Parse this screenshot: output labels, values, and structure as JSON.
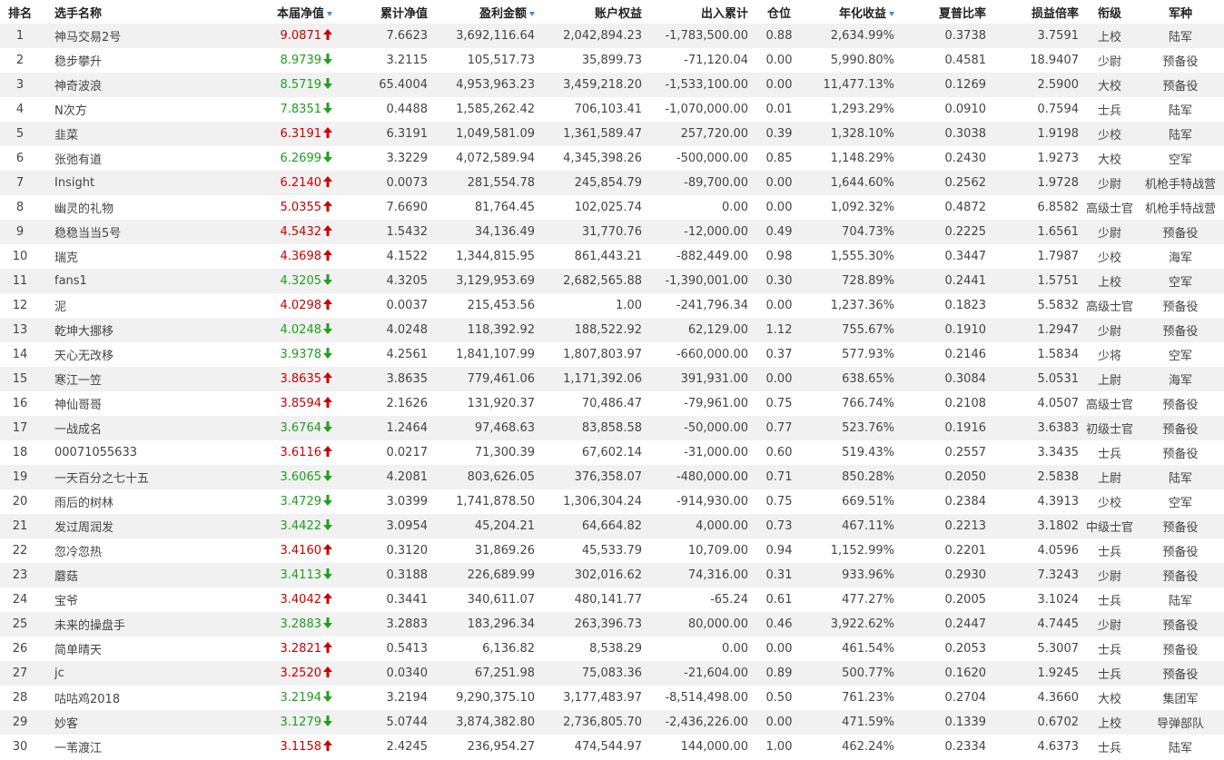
{
  "header": {
    "rank": "排名",
    "name": "选手名称",
    "nav": "本届净值",
    "cum_nav": "累计净值",
    "profit": "盈利金额",
    "equity": "账户权益",
    "flow": "出入累计",
    "position": "仓位",
    "annual": "年化收益",
    "sharpe": "夏普比率",
    "pl_ratio": "损益倍率",
    "title": "衔级",
    "branch": "军种"
  },
  "sorted_columns": [
    "nav",
    "profit",
    "annual"
  ],
  "colors": {
    "up": "#cc0000",
    "down": "#1ea01e",
    "sort_icon": "#3a8ee6",
    "stripe": "#f1f1f1"
  },
  "rows": [
    {
      "rank": "1",
      "name": "神马交易2号",
      "nav": "9.0871",
      "dir": "up",
      "cum_nav": "7.6623",
      "profit": "3,692,116.64",
      "equity": "2,042,894.23",
      "flow": "-1,783,500.00",
      "position": "0.88",
      "annual": "2,634.99%",
      "sharpe": "0.3738",
      "pl_ratio": "3.7591",
      "title": "上校",
      "branch": "陆军"
    },
    {
      "rank": "2",
      "name": "稳步攀升",
      "nav": "8.9739",
      "dir": "down",
      "cum_nav": "3.2115",
      "profit": "105,517.73",
      "equity": "35,899.73",
      "flow": "-71,120.04",
      "position": "0.00",
      "annual": "5,990.80%",
      "sharpe": "0.4581",
      "pl_ratio": "18.9407",
      "title": "少尉",
      "branch": "预备役"
    },
    {
      "rank": "3",
      "name": "神奇波浪",
      "nav": "8.5719",
      "dir": "down",
      "cum_nav": "65.4004",
      "profit": "4,953,963.23",
      "equity": "3,459,218.20",
      "flow": "-1,533,100.00",
      "position": "0.00",
      "annual": "11,477.13%",
      "sharpe": "0.1269",
      "pl_ratio": "2.5900",
      "title": "大校",
      "branch": "预备役"
    },
    {
      "rank": "4",
      "name": "N次方",
      "nav": "7.8351",
      "dir": "down",
      "cum_nav": "0.4488",
      "profit": "1,585,262.42",
      "equity": "706,103.41",
      "flow": "-1,070,000.00",
      "position": "0.01",
      "annual": "1,293.29%",
      "sharpe": "0.0910",
      "pl_ratio": "0.7594",
      "title": "士兵",
      "branch": "陆军"
    },
    {
      "rank": "5",
      "name": "韭菜",
      "nav": "6.3191",
      "dir": "up",
      "cum_nav": "6.3191",
      "profit": "1,049,581.09",
      "equity": "1,361,589.47",
      "flow": "257,720.00",
      "position": "0.39",
      "annual": "1,328.10%",
      "sharpe": "0.3038",
      "pl_ratio": "1.9198",
      "title": "少校",
      "branch": "陆军"
    },
    {
      "rank": "6",
      "name": "张弛有道",
      "nav": "6.2699",
      "dir": "down",
      "cum_nav": "3.3229",
      "profit": "4,072,589.94",
      "equity": "4,345,398.26",
      "flow": "-500,000.00",
      "position": "0.85",
      "annual": "1,148.29%",
      "sharpe": "0.2430",
      "pl_ratio": "1.9273",
      "title": "大校",
      "branch": "空军"
    },
    {
      "rank": "7",
      "name": "Insight",
      "nav": "6.2140",
      "dir": "up",
      "cum_nav": "0.0073",
      "profit": "281,554.78",
      "equity": "245,854.79",
      "flow": "-89,700.00",
      "position": "0.00",
      "annual": "1,644.60%",
      "sharpe": "0.2562",
      "pl_ratio": "1.9728",
      "title": "少尉",
      "branch": "机枪手特战营"
    },
    {
      "rank": "8",
      "name": "幽灵的礼物",
      "nav": "5.0355",
      "dir": "up",
      "cum_nav": "7.6690",
      "profit": "81,764.45",
      "equity": "102,025.74",
      "flow": "0.00",
      "position": "0.00",
      "annual": "1,092.32%",
      "sharpe": "0.4872",
      "pl_ratio": "6.8582",
      "title": "高级士官",
      "branch": "机枪手特战营"
    },
    {
      "rank": "9",
      "name": "稳稳当当5号",
      "nav": "4.5432",
      "dir": "up",
      "cum_nav": "1.5432",
      "profit": "34,136.49",
      "equity": "31,770.76",
      "flow": "-12,000.00",
      "position": "0.49",
      "annual": "704.73%",
      "sharpe": "0.2225",
      "pl_ratio": "1.6561",
      "title": "少尉",
      "branch": "预备役"
    },
    {
      "rank": "10",
      "name": "瑞克",
      "nav": "4.3698",
      "dir": "up",
      "cum_nav": "4.1522",
      "profit": "1,344,815.95",
      "equity": "861,443.21",
      "flow": "-882,449.00",
      "position": "0.98",
      "annual": "1,555.30%",
      "sharpe": "0.3447",
      "pl_ratio": "1.7987",
      "title": "少校",
      "branch": "海军"
    },
    {
      "rank": "11",
      "name": "fans1",
      "nav": "4.3205",
      "dir": "down",
      "cum_nav": "4.3205",
      "profit": "3,129,953.69",
      "equity": "2,682,565.88",
      "flow": "-1,390,001.00",
      "position": "0.30",
      "annual": "728.89%",
      "sharpe": "0.2441",
      "pl_ratio": "1.5751",
      "title": "上校",
      "branch": "空军"
    },
    {
      "rank": "12",
      "name": "泥",
      "nav": "4.0298",
      "dir": "up",
      "cum_nav": "0.0037",
      "profit": "215,453.56",
      "equity": "1.00",
      "flow": "-241,796.34",
      "position": "0.00",
      "annual": "1,237.36%",
      "sharpe": "0.1823",
      "pl_ratio": "5.5832",
      "title": "高级士官",
      "branch": "预备役"
    },
    {
      "rank": "13",
      "name": "乾坤大挪移",
      "nav": "4.0248",
      "dir": "down",
      "cum_nav": "4.0248",
      "profit": "118,392.92",
      "equity": "188,522.92",
      "flow": "62,129.00",
      "position": "1.12",
      "annual": "755.67%",
      "sharpe": "0.1910",
      "pl_ratio": "1.2947",
      "title": "少尉",
      "branch": "预备役"
    },
    {
      "rank": "14",
      "name": "天心无改移",
      "nav": "3.9378",
      "dir": "down",
      "cum_nav": "4.2561",
      "profit": "1,841,107.99",
      "equity": "1,807,803.97",
      "flow": "-660,000.00",
      "position": "0.37",
      "annual": "577.93%",
      "sharpe": "0.2146",
      "pl_ratio": "1.5834",
      "title": "少将",
      "branch": "空军"
    },
    {
      "rank": "15",
      "name": "寒江一笠",
      "nav": "3.8635",
      "dir": "up",
      "cum_nav": "3.8635",
      "profit": "779,461.06",
      "equity": "1,171,392.06",
      "flow": "391,931.00",
      "position": "0.00",
      "annual": "638.65%",
      "sharpe": "0.3084",
      "pl_ratio": "5.0531",
      "title": "上尉",
      "branch": "海军"
    },
    {
      "rank": "16",
      "name": "神仙哥哥",
      "nav": "3.8594",
      "dir": "up",
      "cum_nav": "2.1626",
      "profit": "131,920.37",
      "equity": "70,486.47",
      "flow": "-79,961.00",
      "position": "0.75",
      "annual": "766.74%",
      "sharpe": "0.2108",
      "pl_ratio": "4.0507",
      "title": "高级士官",
      "branch": "预备役"
    },
    {
      "rank": "17",
      "name": "一战成名",
      "nav": "3.6764",
      "dir": "down",
      "cum_nav": "1.2464",
      "profit": "97,468.63",
      "equity": "83,858.58",
      "flow": "-50,000.00",
      "position": "0.77",
      "annual": "523.76%",
      "sharpe": "0.1916",
      "pl_ratio": "3.6383",
      "title": "初级士官",
      "branch": "预备役"
    },
    {
      "rank": "18",
      "name": "00071055633",
      "nav": "3.6116",
      "dir": "up",
      "cum_nav": "0.0217",
      "profit": "71,300.39",
      "equity": "67,602.14",
      "flow": "-31,000.00",
      "position": "0.60",
      "annual": "519.43%",
      "sharpe": "0.2557",
      "pl_ratio": "3.3435",
      "title": "士兵",
      "branch": "预备役"
    },
    {
      "rank": "19",
      "name": "一天百分之七十五",
      "nav": "3.6065",
      "dir": "down",
      "cum_nav": "4.2081",
      "profit": "803,626.05",
      "equity": "376,358.07",
      "flow": "-480,000.00",
      "position": "0.71",
      "annual": "850.28%",
      "sharpe": "0.2050",
      "pl_ratio": "2.5838",
      "title": "上尉",
      "branch": "陆军"
    },
    {
      "rank": "20",
      "name": "雨后的树林",
      "nav": "3.4729",
      "dir": "down",
      "cum_nav": "3.0399",
      "profit": "1,741,878.50",
      "equity": "1,306,304.24",
      "flow": "-914,930.00",
      "position": "0.75",
      "annual": "669.51%",
      "sharpe": "0.2384",
      "pl_ratio": "4.3913",
      "title": "少校",
      "branch": "空军"
    },
    {
      "rank": "21",
      "name": "发过周润发",
      "nav": "3.4422",
      "dir": "down",
      "cum_nav": "3.0954",
      "profit": "45,204.21",
      "equity": "64,664.82",
      "flow": "4,000.00",
      "position": "0.73",
      "annual": "467.11%",
      "sharpe": "0.2213",
      "pl_ratio": "3.1802",
      "title": "中级士官",
      "branch": "预备役"
    },
    {
      "rank": "22",
      "name": "忽冷忽热",
      "nav": "3.4160",
      "dir": "up",
      "cum_nav": "0.3120",
      "profit": "31,869.26",
      "equity": "45,533.79",
      "flow": "10,709.00",
      "position": "0.94",
      "annual": "1,152.99%",
      "sharpe": "0.2201",
      "pl_ratio": "4.0596",
      "title": "士兵",
      "branch": "预备役"
    },
    {
      "rank": "23",
      "name": "蘑菇",
      "nav": "3.4113",
      "dir": "down",
      "cum_nav": "0.3188",
      "profit": "226,689.99",
      "equity": "302,016.62",
      "flow": "74,316.00",
      "position": "0.31",
      "annual": "933.96%",
      "sharpe": "0.2930",
      "pl_ratio": "7.3243",
      "title": "少尉",
      "branch": "预备役"
    },
    {
      "rank": "24",
      "name": "宝爷",
      "nav": "3.4042",
      "dir": "up",
      "cum_nav": "0.3441",
      "profit": "340,611.07",
      "equity": "480,141.77",
      "flow": "-65.24",
      "position": "0.61",
      "annual": "477.27%",
      "sharpe": "0.2005",
      "pl_ratio": "3.1024",
      "title": "士兵",
      "branch": "陆军"
    },
    {
      "rank": "25",
      "name": "未来的操盘手",
      "nav": "3.2883",
      "dir": "down",
      "cum_nav": "3.2883",
      "profit": "183,296.34",
      "equity": "263,396.73",
      "flow": "80,000.00",
      "position": "0.46",
      "annual": "3,922.62%",
      "sharpe": "0.2447",
      "pl_ratio": "4.7445",
      "title": "少尉",
      "branch": "预备役"
    },
    {
      "rank": "26",
      "name": "简单晴天",
      "nav": "3.2821",
      "dir": "up",
      "cum_nav": "0.5413",
      "profit": "6,136.82",
      "equity": "8,538.29",
      "flow": "0.00",
      "position": "0.00",
      "annual": "461.54%",
      "sharpe": "0.2053",
      "pl_ratio": "5.3007",
      "title": "士兵",
      "branch": "预备役"
    },
    {
      "rank": "27",
      "name": "jc",
      "nav": "3.2520",
      "dir": "up",
      "cum_nav": "0.0340",
      "profit": "67,251.98",
      "equity": "75,083.36",
      "flow": "-21,604.00",
      "position": "0.89",
      "annual": "500.77%",
      "sharpe": "0.1620",
      "pl_ratio": "1.9245",
      "title": "士兵",
      "branch": "预备役"
    },
    {
      "rank": "28",
      "name": "咕咕鸡2018",
      "nav": "3.2194",
      "dir": "down",
      "cum_nav": "3.2194",
      "profit": "9,290,375.10",
      "equity": "3,177,483.97",
      "flow": "-8,514,498.00",
      "position": "0.50",
      "annual": "761.23%",
      "sharpe": "0.2704",
      "pl_ratio": "4.3660",
      "title": "大校",
      "branch": "集团军"
    },
    {
      "rank": "29",
      "name": "妙客",
      "nav": "3.1279",
      "dir": "down",
      "cum_nav": "5.0744",
      "profit": "3,874,382.80",
      "equity": "2,736,805.70",
      "flow": "-2,436,226.00",
      "position": "0.00",
      "annual": "471.59%",
      "sharpe": "0.1339",
      "pl_ratio": "0.6702",
      "title": "上校",
      "branch": "导弹部队"
    },
    {
      "rank": "30",
      "name": "一苇渡江",
      "nav": "3.1158",
      "dir": "up",
      "cum_nav": "2.4245",
      "profit": "236,954.27",
      "equity": "474,544.97",
      "flow": "144,000.00",
      "position": "1.00",
      "annual": "462.24%",
      "sharpe": "0.2334",
      "pl_ratio": "4.6373",
      "title": "士兵",
      "branch": "陆军"
    }
  ]
}
